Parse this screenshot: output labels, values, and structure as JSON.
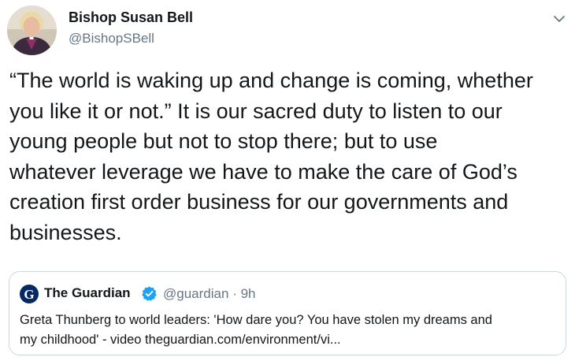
{
  "tweet": {
    "author": {
      "name": "Bishop Susan Bell",
      "handle": "@BishopSBell"
    },
    "text_lines": [
      "“The world is waking up and change is coming, whether",
      "you like it or not.”  It is our sacred duty to listen to our",
      "young people but not to stop there; but to use",
      "whatever leverage we have to make the care of God’s",
      "creation first order business for our governments and",
      "businesses."
    ],
    "menu_icon": "chevron-down-icon"
  },
  "quote": {
    "author": {
      "name": "The Guardian",
      "handle": "@guardian",
      "separator": "·",
      "time": "9h",
      "verified": true
    },
    "text_lines": [
      "Greta Thunberg to world leaders: 'How dare you? You have stolen my dreams and",
      "my childhood' - video theguardian.com/environment/vi..."
    ],
    "logo_icon": "guardian-logo-icon",
    "verified_icon": "verified-badge-icon"
  },
  "colors": {
    "primary_text": "#14171a",
    "secondary_text": "#657786",
    "border": "#ccd6dd",
    "verified_blue": "#1da1f2",
    "guardian_navy": "#052962"
  }
}
